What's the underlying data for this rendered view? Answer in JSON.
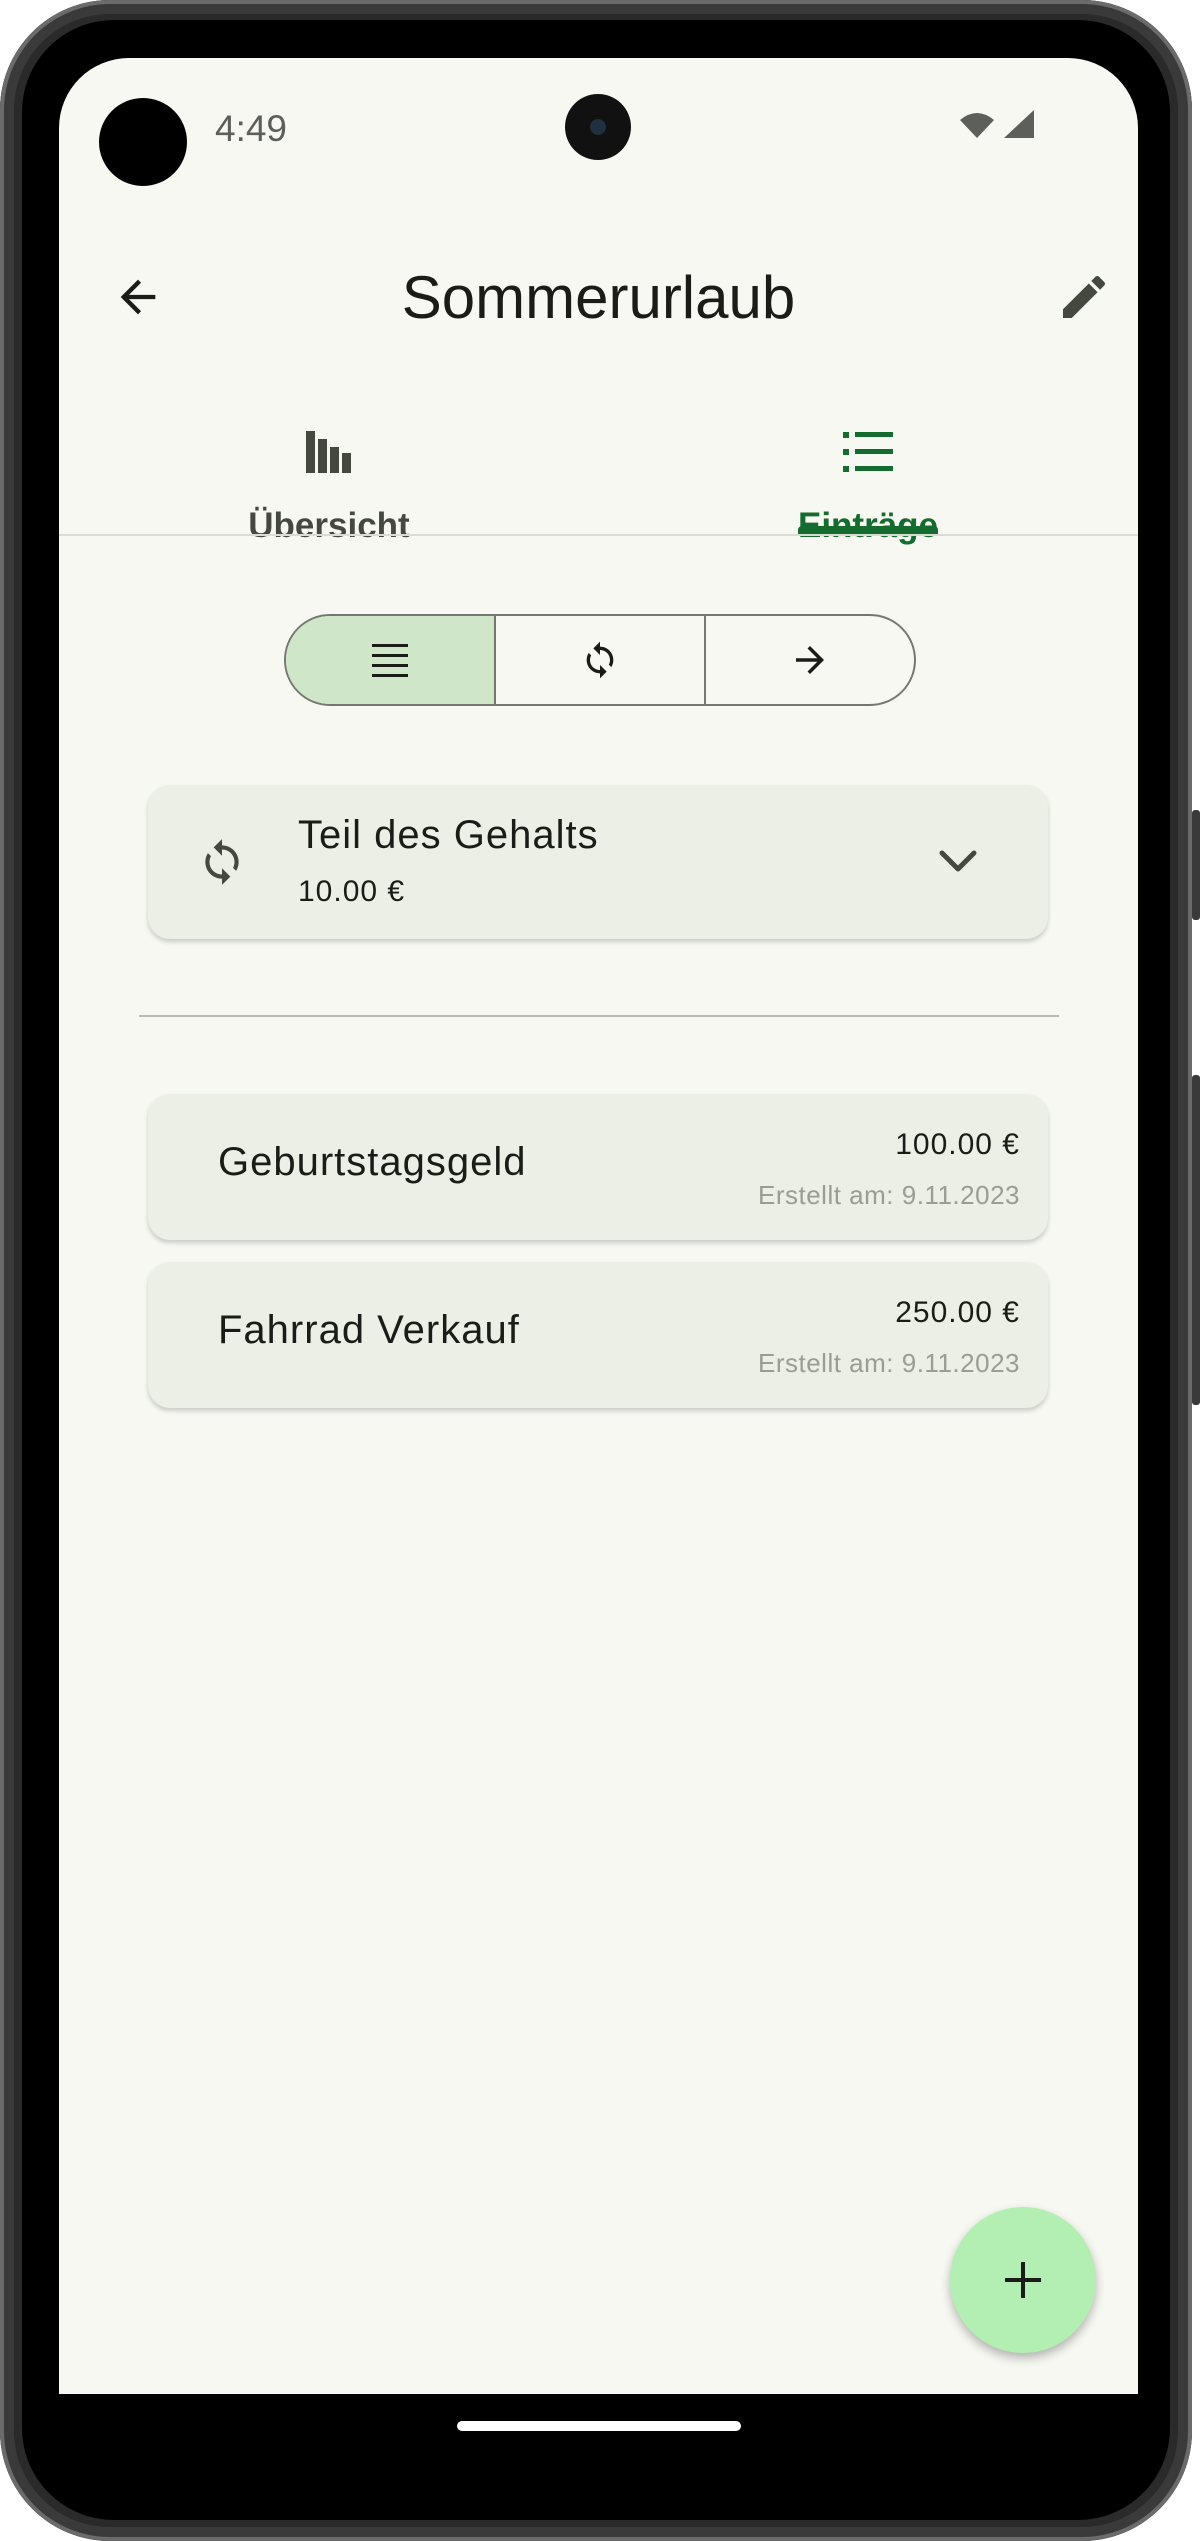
{
  "status_bar": {
    "time": "4:49"
  },
  "app_bar": {
    "title": "Sommerurlaub"
  },
  "tabs": [
    {
      "label": "Übersicht",
      "icon": "bar-chart-icon",
      "selected": false
    },
    {
      "label": "Einträge",
      "icon": "list-icon",
      "selected": true
    }
  ],
  "filter": {
    "segments": [
      {
        "icon": "list-lines-icon",
        "selected": true
      },
      {
        "icon": "sync-icon",
        "selected": false
      },
      {
        "icon": "arrow-right-icon",
        "selected": false
      }
    ]
  },
  "recurring": {
    "title": "Teil des Gehalts",
    "amount": "10.00 €"
  },
  "entries": [
    {
      "name": "Geburtstagsgeld",
      "amount": "100.00 €",
      "created": "Erstellt am: 9.11.2023"
    },
    {
      "name": "Fahrrad Verkauf",
      "amount": "250.00 €",
      "created": "Erstellt am: 9.11.2023"
    }
  ],
  "colors": {
    "accent": "#146c2e",
    "segment_selected": "#cfe6c9",
    "card_bg": "#ebefe6",
    "fab_bg": "#b3efb2",
    "screen_bg": "#f7f8f2"
  }
}
